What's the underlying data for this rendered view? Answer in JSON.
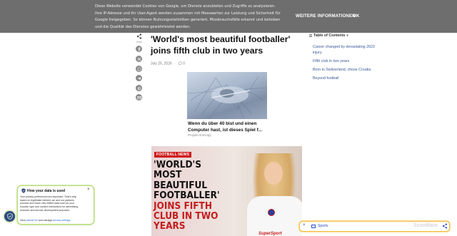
{
  "cookie_banner": {
    "text": "Diese Website verwendet Cookies von Google, um Dienste anzubieten und Zugriffe zu analysieren. Ihre IP-Adresse und Ihr User-Agent werden zusammen mit Messwerten zur Leistung und Sicherheit für Google freigegeben. So können Nutzungsstatistiken generiert, Missbrauchsfälle erkannt und behoben und die Qualität des Dienstes gewährleistet werden.",
    "more_info_label": "WEITERE INFORMATIONEN",
    "ok_label": "OK"
  },
  "share": {
    "label": "Share",
    "buttons": [
      "facebook-icon",
      "x-icon",
      "whatsapp-icon",
      "telegram-icon",
      "pinterest-icon",
      "email-icon"
    ]
  },
  "article": {
    "title": "'World's most beautiful footballer' joins fifth club in two years",
    "date": "July 25, 2026",
    "comments": "0"
  },
  "ad": {
    "title": "Wenn du über 40 bist und einen Computer hast, ist dieses Spiel f...",
    "sponsor": "Projekt Entropy"
  },
  "image": {
    "badge": "FOOTBALL NEWS",
    "headline_black": "'WORLD'S MOST BEAUTIFUL FOOTBALLER'",
    "headline_red": "JOINS FIFTH CLUB IN TWO YEARS",
    "shirt_text": "SuperSport"
  },
  "toc": {
    "title": "Table of Contents",
    "items": [
      "Career changed by devastating 2023 injury",
      "Fifth club in two years",
      "Born in Switzerland, chose Croatia",
      "Beyond football"
    ]
  },
  "privacy": {
    "title": "How your data is used",
    "body": "Your privacy preferences are important. That's why, based on legitimate interest, we and our partners process and share only limited data such as your browser type and content interactions for advertising, research and service development purposes.",
    "links_prefix": "View ",
    "partner_list": "partner list",
    "links_middle": " and manage ",
    "privacy_settings": "privacy settings",
    "links_suffix": "."
  },
  "sports_bar": {
    "label": "Sports",
    "watermark": "ScanMate"
  },
  "colors": {
    "banner_bg": "#6e6e6e",
    "link_blue": "#3b5998",
    "accent_red": "#c41d1d",
    "privacy_border": "#b9e07a",
    "sports_border": "#f2c34a"
  }
}
